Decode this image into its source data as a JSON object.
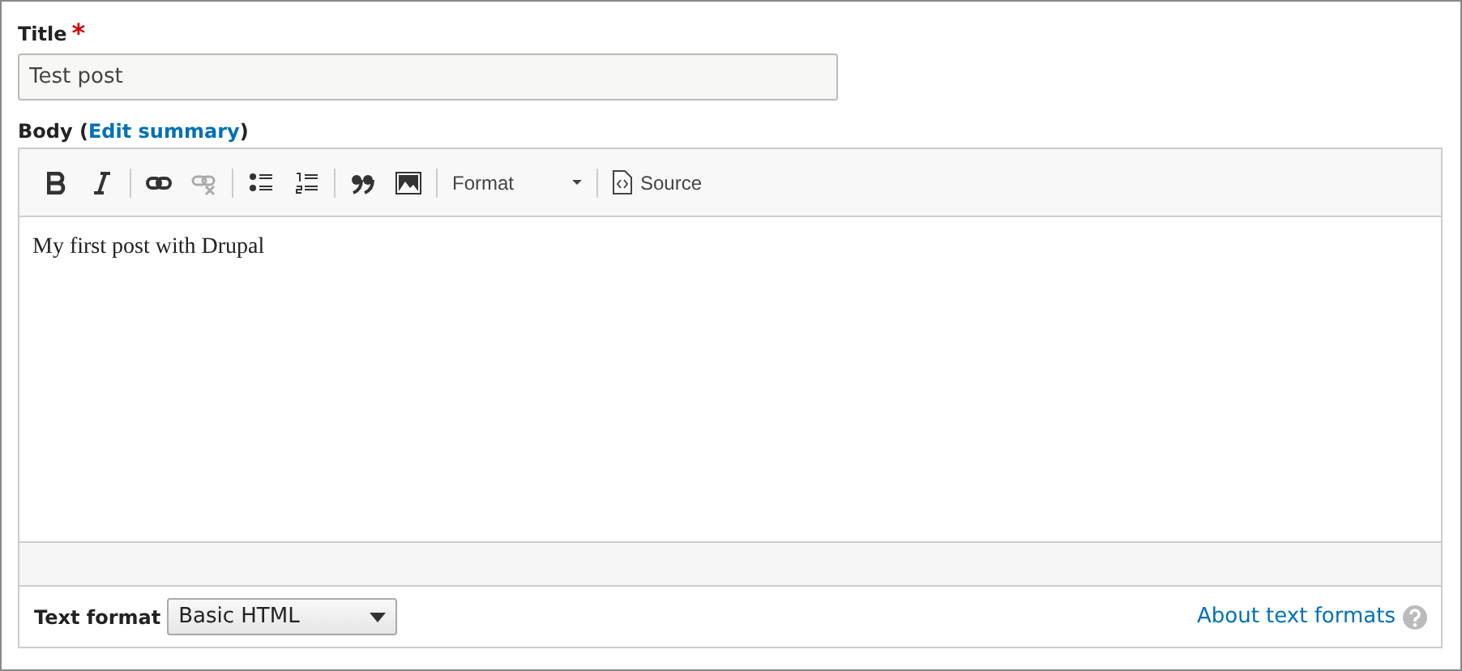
{
  "title_field": {
    "label": "Title",
    "required_mark": "*",
    "value": "Test post"
  },
  "body_field": {
    "label": "Body (",
    "link": "Edit summary",
    "label_end": ")",
    "toolbar": [
      {
        "kind": "bold",
        "disabled": false
      },
      {
        "kind": "italic",
        "disabled": false
      },
      {
        "kind": "separator"
      },
      {
        "kind": "link",
        "disabled": false
      },
      {
        "kind": "unlink",
        "disabled": true
      },
      {
        "kind": "separator"
      },
      {
        "kind": "bullets",
        "disabled": false
      },
      {
        "kind": "numbers",
        "disabled": false
      },
      {
        "kind": "separator"
      },
      {
        "kind": "quote",
        "disabled": false
      },
      {
        "kind": "image",
        "disabled": false
      },
      {
        "kind": "separator"
      },
      {
        "kind": "combo",
        "label": "Format"
      },
      {
        "kind": "separator"
      },
      {
        "kind": "source",
        "label": "Source"
      }
    ],
    "content": "My first post with Drupal"
  },
  "text_format": {
    "label": "Text format",
    "value": "Basic HTML",
    "help_link": "About text formats"
  }
}
